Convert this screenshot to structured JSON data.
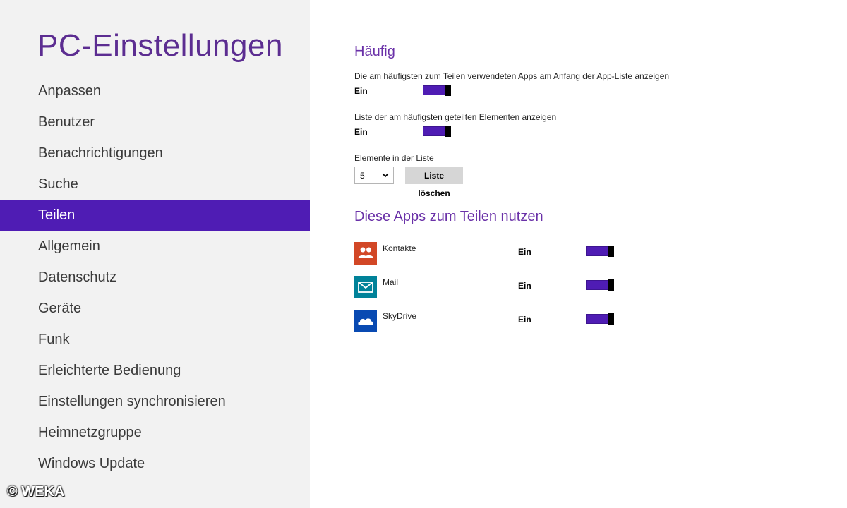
{
  "sidebar": {
    "title": "PC-Einstellungen",
    "items": [
      {
        "label": "Anpassen"
      },
      {
        "label": "Benutzer"
      },
      {
        "label": "Benachrichtigungen"
      },
      {
        "label": "Suche"
      },
      {
        "label": "Teilen",
        "selected": true
      },
      {
        "label": "Allgemein"
      },
      {
        "label": "Datenschutz"
      },
      {
        "label": "Geräte"
      },
      {
        "label": "Funk"
      },
      {
        "label": "Erleichterte Bedienung"
      },
      {
        "label": "Einstellungen synchronisieren"
      },
      {
        "label": "Heimnetzgruppe"
      },
      {
        "label": "Windows Update"
      }
    ]
  },
  "watermark": "© WEKA",
  "main": {
    "frequent": {
      "heading": "Häufig",
      "setting1": {
        "label": "Die am häufigsten zum Teilen verwendeten Apps am Anfang der App-Liste anzeigen",
        "state": "Ein"
      },
      "setting2": {
        "label": "Liste der am häufigsten geteilten Elementen anzeigen",
        "state": "Ein"
      },
      "list_count": {
        "label": "Elemente in der Liste",
        "value": "5"
      },
      "clear_button": "Liste löschen"
    },
    "apps": {
      "heading": "Diese Apps zum Teilen nutzen",
      "items": [
        {
          "name": "Kontakte",
          "state": "Ein",
          "icon": "people-icon",
          "color": "#d24726"
        },
        {
          "name": "Mail",
          "state": "Ein",
          "icon": "mail-icon",
          "color": "#008299"
        },
        {
          "name": "SkyDrive",
          "state": "Ein",
          "icon": "cloud-icon",
          "color": "#094ab2"
        }
      ]
    }
  },
  "colors": {
    "accent": "#4f1cb4",
    "title": "#5c2d91",
    "heading": "#6a31a8",
    "sidebar_bg": "#f2f2f2"
  }
}
